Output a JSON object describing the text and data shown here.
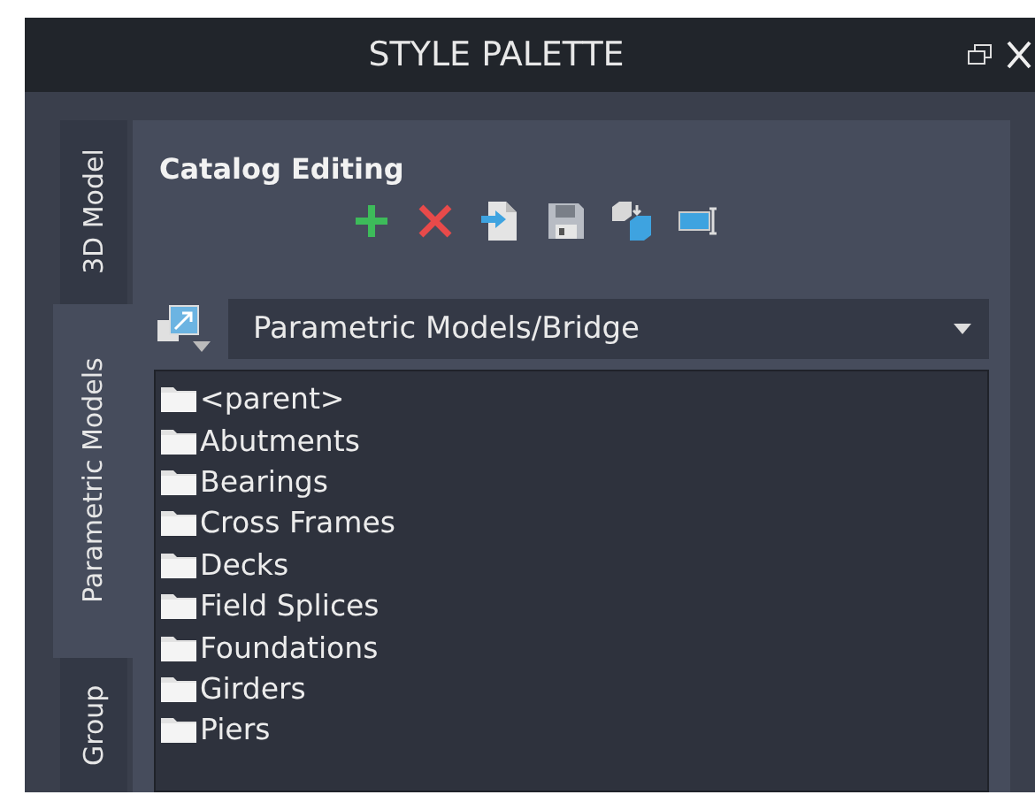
{
  "window": {
    "title": "STYLE PALETTE"
  },
  "tabs": [
    {
      "label": "3D Model",
      "selected": false
    },
    {
      "label": "Parametric Models",
      "selected": true
    },
    {
      "label": "Group",
      "selected": false
    }
  ],
  "panel": {
    "heading": "Catalog Editing",
    "dropdown": {
      "value": "Parametric Models/Bridge"
    },
    "folders": [
      {
        "label": "<parent>"
      },
      {
        "label": "Abutments"
      },
      {
        "label": "Bearings"
      },
      {
        "label": "Cross Frames"
      },
      {
        "label": "Decks"
      },
      {
        "label": "Field Splices"
      },
      {
        "label": "Foundations"
      },
      {
        "label": "Girders"
      },
      {
        "label": "Piers"
      }
    ]
  }
}
